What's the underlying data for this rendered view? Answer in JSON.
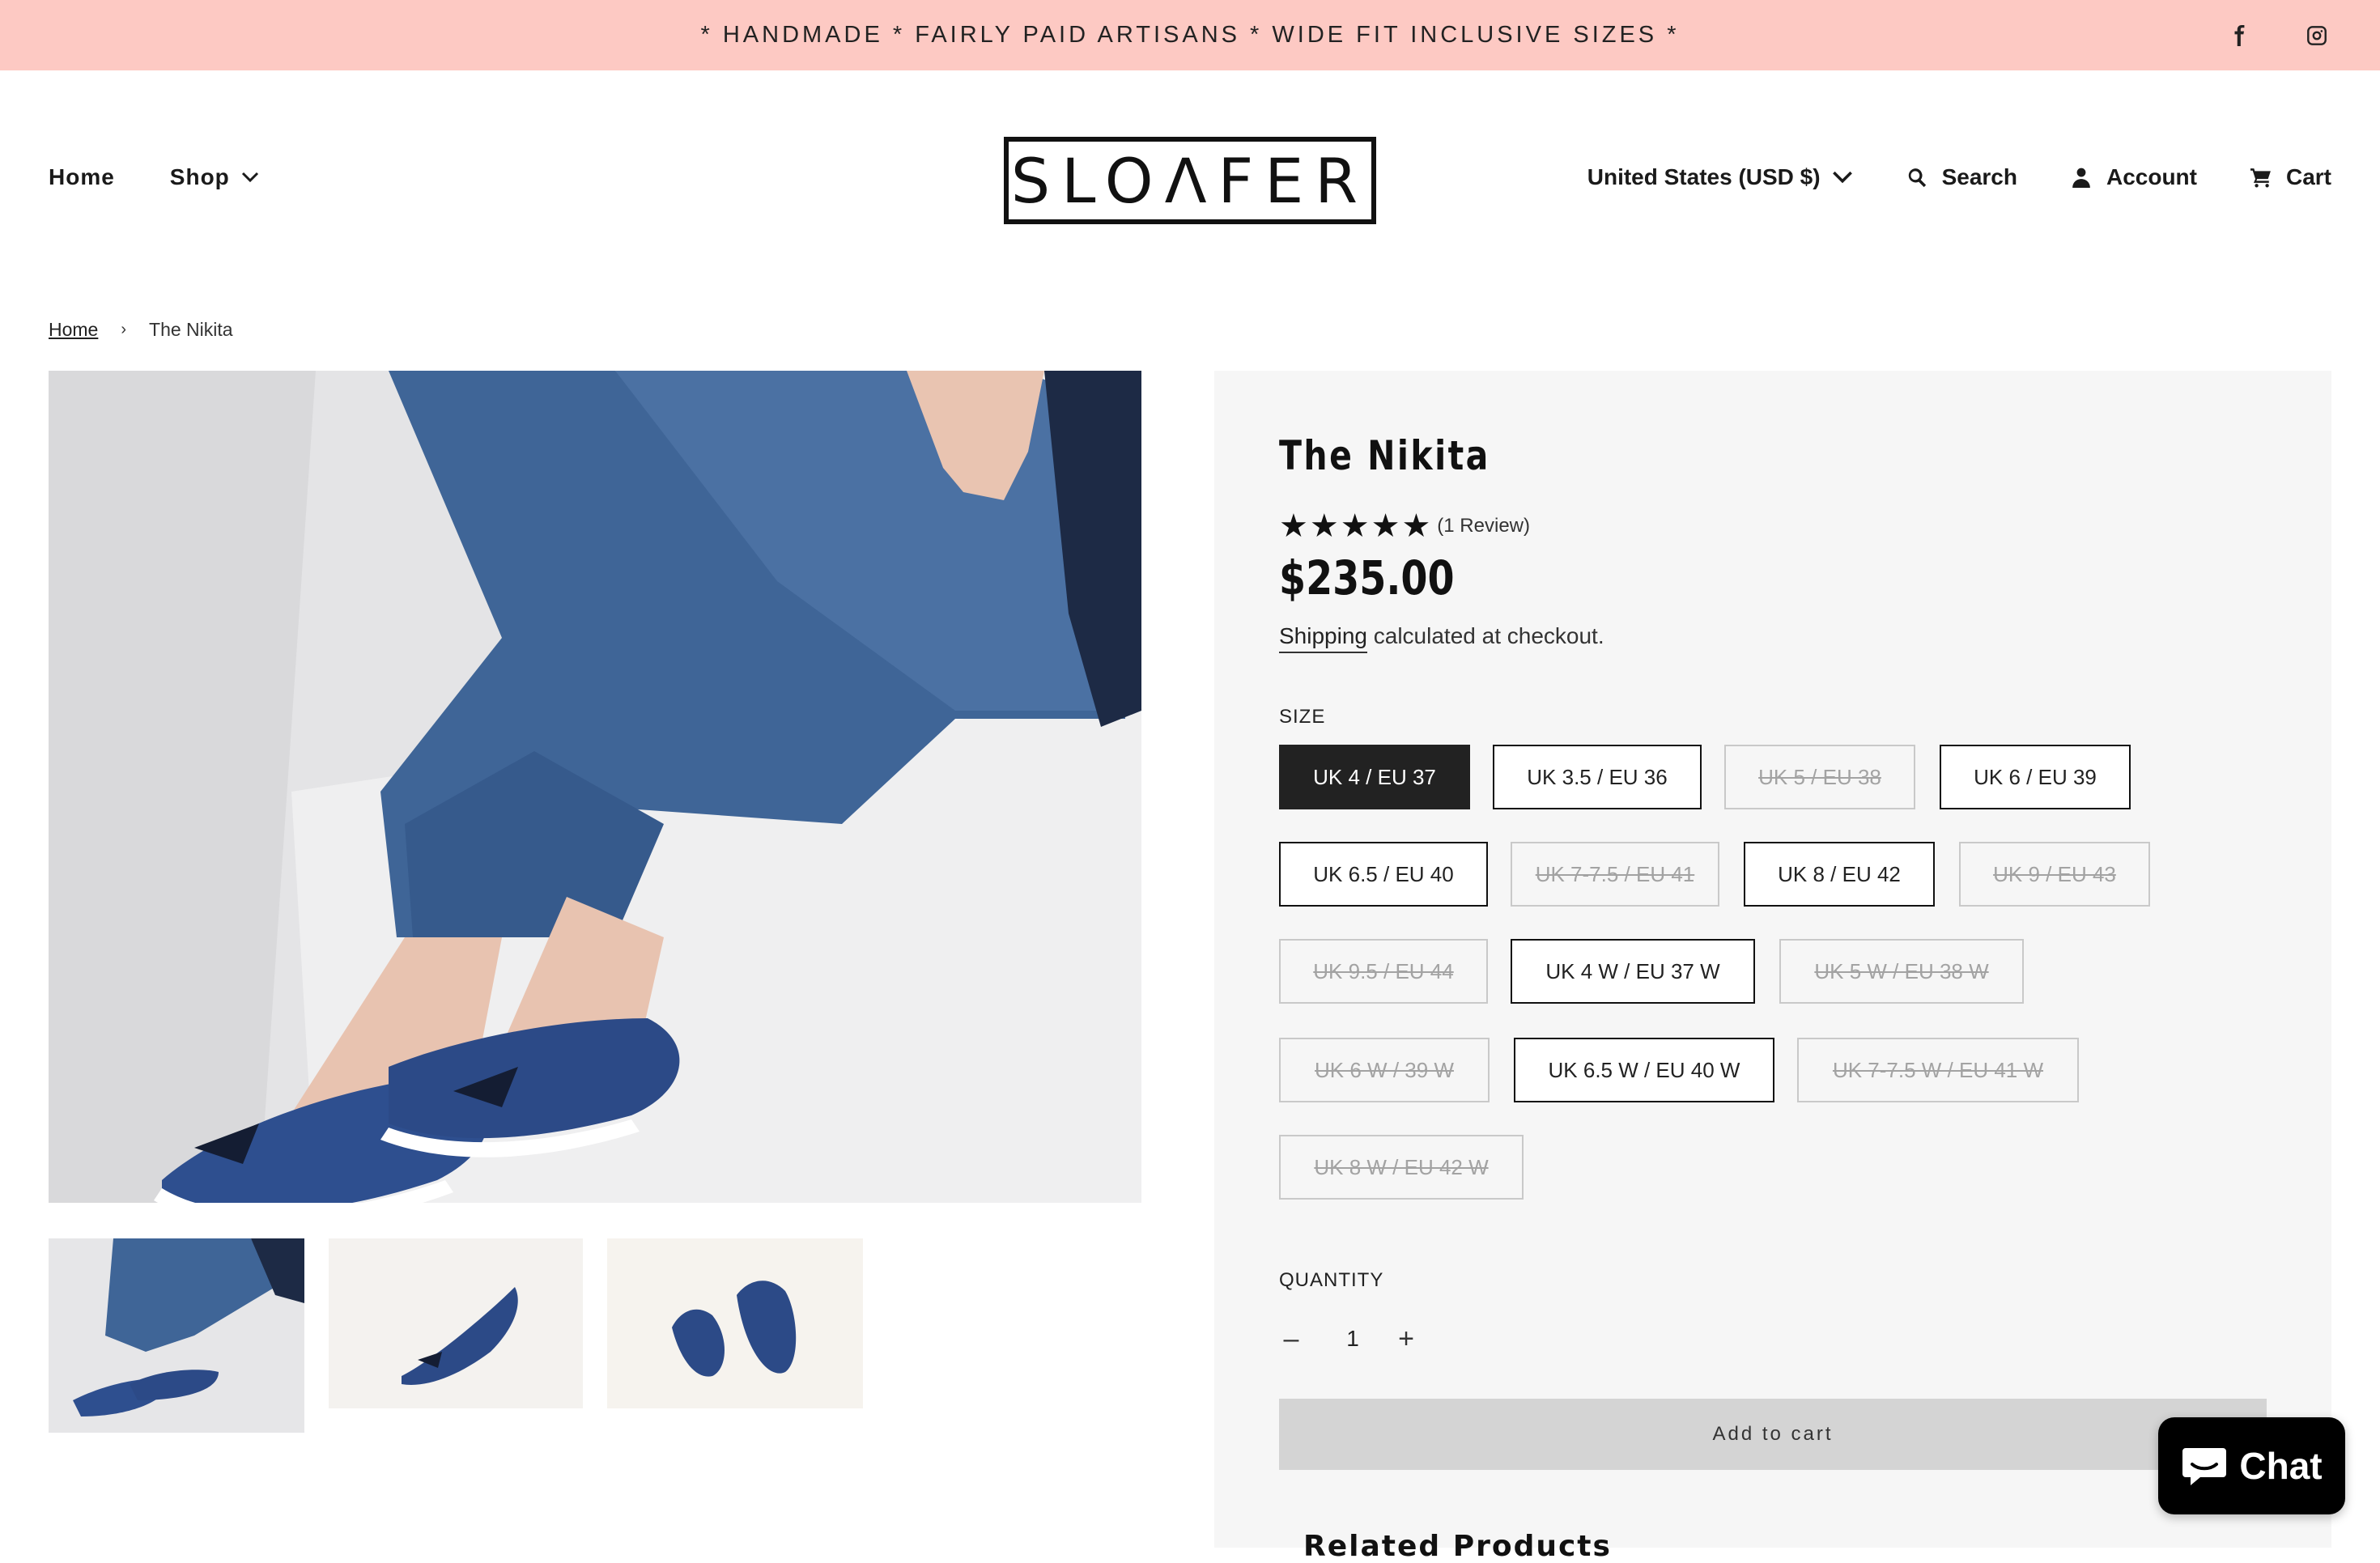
{
  "announcement": "* HANDMADE * FAIRLY PAID ARTISANS * WIDE FIT INCLUSIVE SIZES *",
  "social": {
    "facebook_icon": "facebook-icon",
    "instagram_icon": "instagram-icon"
  },
  "nav": {
    "home": "Home",
    "shop": "Shop",
    "currency": "United States (USD $)",
    "search": "Search",
    "account": "Account",
    "cart": "Cart"
  },
  "logo": "SLOΛFER",
  "breadcrumb": {
    "home": "Home",
    "separator": "›",
    "current": "The Nikita"
  },
  "product": {
    "title": "The Nikita",
    "rating_stars": 5,
    "stars": [
      "★",
      "★",
      "★",
      "★",
      "★"
    ],
    "review_text": "(1 Review)",
    "price": "$235.00",
    "shipping_link": "Shipping",
    "shipping_rest": " calculated at checkout.",
    "size_label": "SIZE",
    "sizes": [
      {
        "label": "UK 4 / EU 37",
        "state": "selected"
      },
      {
        "label": "UK 3.5 / EU 36",
        "state": "available"
      },
      {
        "label": "UK 5 / EU 38",
        "state": "unavailable"
      },
      {
        "label": "UK 6 / EU 39",
        "state": "available"
      },
      {
        "label": "UK 6.5 / EU 40",
        "state": "available"
      },
      {
        "label": "UK 7-7.5 / EU 41",
        "state": "unavailable"
      },
      {
        "label": "UK 8 / EU 42",
        "state": "available"
      },
      {
        "label": "UK 9 / EU 43",
        "state": "unavailable"
      },
      {
        "label": "UK 9.5 / EU 44",
        "state": "unavailable"
      },
      {
        "label": "UK 4 W / EU 37 W",
        "state": "available"
      },
      {
        "label": "UK 5 W / EU 38 W",
        "state": "unavailable"
      },
      {
        "label": "UK 6 W / 39 W",
        "state": "unavailable"
      },
      {
        "label": "UK 6.5 W / EU 40 W",
        "state": "available"
      },
      {
        "label": "UK 7-7.5 W / EU 41 W",
        "state": "unavailable"
      },
      {
        "label": "UK 8 W / EU 42 W",
        "state": "unavailable"
      }
    ],
    "quantity_label": "QUANTITY",
    "qty_minus": "–",
    "quantity": "1",
    "qty_plus": "+",
    "add_to_cart": "Add to cart",
    "related_heading": "Related Products"
  },
  "chat": {
    "label": "Chat",
    "icon": "chat-bubble-icon"
  },
  "colors": {
    "announcement_bg": "#fdc9c3",
    "panel_bg": "#f6f6f6",
    "selected_bg": "#222222",
    "chat_bg": "#000000"
  }
}
